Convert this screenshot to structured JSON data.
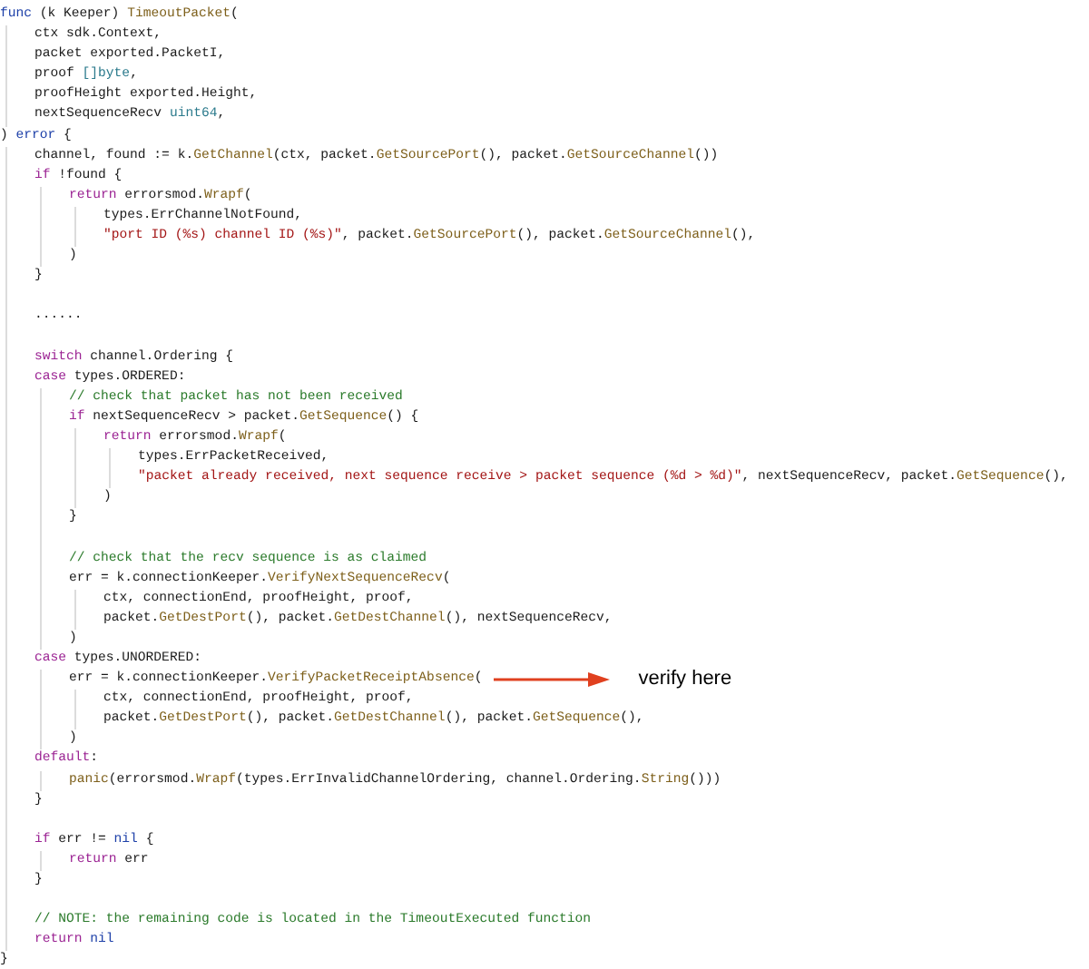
{
  "code": {
    "lines": [
      {
        "kind": "code",
        "tokens": [
          {
            "kind": "d",
            "text": "func"
          },
          {
            "kind": "p",
            "text": " (k Keeper) "
          },
          {
            "kind": "f",
            "text": "TimeoutPacket"
          },
          {
            "kind": "p",
            "text": "("
          }
        ],
        "children": [
          {
            "kind": "code",
            "tokens": [
              {
                "kind": "p",
                "text": "ctx sdk.Context,"
              }
            ]
          },
          {
            "kind": "code",
            "tokens": [
              {
                "kind": "p",
                "text": "packet exported.PacketI,"
              }
            ]
          },
          {
            "kind": "code",
            "tokens": [
              {
                "kind": "p",
                "text": "proof "
              },
              {
                "kind": "t",
                "text": "[]byte"
              },
              {
                "kind": "p",
                "text": ","
              }
            ]
          },
          {
            "kind": "code",
            "tokens": [
              {
                "kind": "p",
                "text": "proofHeight exported.Height,"
              }
            ]
          },
          {
            "kind": "code",
            "tokens": [
              {
                "kind": "p",
                "text": "nextSequenceRecv "
              },
              {
                "kind": "t",
                "text": "uint64"
              },
              {
                "kind": "p",
                "text": ","
              }
            ]
          }
        ]
      },
      {
        "kind": "code",
        "tokens": [
          {
            "kind": "p",
            "text": ") "
          },
          {
            "kind": "d",
            "text": "error"
          },
          {
            "kind": "p",
            "text": " {"
          }
        ],
        "children": [
          {
            "kind": "code",
            "tokens": [
              {
                "kind": "p",
                "text": "channel, found := k."
              },
              {
                "kind": "f",
                "text": "GetChannel"
              },
              {
                "kind": "p",
                "text": "(ctx, packet."
              },
              {
                "kind": "f",
                "text": "GetSourcePort"
              },
              {
                "kind": "p",
                "text": "(), packet."
              },
              {
                "kind": "f",
                "text": "GetSourceChannel"
              },
              {
                "kind": "p",
                "text": "())"
              }
            ]
          },
          {
            "kind": "code",
            "tokens": [
              {
                "kind": "k",
                "text": "if"
              },
              {
                "kind": "p",
                "text": " !found {"
              }
            ],
            "children": [
              {
                "kind": "code",
                "tokens": [
                  {
                    "kind": "k",
                    "text": "return"
                  },
                  {
                    "kind": "p",
                    "text": " errorsmod."
                  },
                  {
                    "kind": "f",
                    "text": "Wrapf"
                  },
                  {
                    "kind": "p",
                    "text": "("
                  }
                ],
                "children": [
                  {
                    "kind": "code",
                    "tokens": [
                      {
                        "kind": "p",
                        "text": "types.ErrChannelNotFound,"
                      }
                    ]
                  },
                  {
                    "kind": "code",
                    "tokens": [
                      {
                        "kind": "s",
                        "text": "\"port ID (%s) channel ID (%s)\""
                      },
                      {
                        "kind": "p",
                        "text": ", packet."
                      },
                      {
                        "kind": "f",
                        "text": "GetSourcePort"
                      },
                      {
                        "kind": "p",
                        "text": "(), packet."
                      },
                      {
                        "kind": "f",
                        "text": "GetSourceChannel"
                      },
                      {
                        "kind": "p",
                        "text": "(),"
                      }
                    ]
                  }
                ]
              },
              {
                "kind": "code",
                "tokens": [
                  {
                    "kind": "p",
                    "text": ")"
                  }
                ]
              }
            ]
          },
          {
            "kind": "code",
            "tokens": [
              {
                "kind": "p",
                "text": "}"
              }
            ]
          },
          {
            "kind": "blank"
          },
          {
            "kind": "code",
            "tokens": [
              {
                "kind": "p",
                "text": "......"
              }
            ]
          },
          {
            "kind": "blank"
          },
          {
            "kind": "code",
            "tokens": [
              {
                "kind": "k",
                "text": "switch"
              },
              {
                "kind": "p",
                "text": " channel.Ordering {"
              }
            ]
          },
          {
            "kind": "code",
            "tokens": [
              {
                "kind": "k",
                "text": "case"
              },
              {
                "kind": "p",
                "text": " types.ORDERED:"
              }
            ],
            "children": [
              {
                "kind": "code",
                "tokens": [
                  {
                    "kind": "c",
                    "text": "// check that packet has not been received"
                  }
                ]
              },
              {
                "kind": "code",
                "tokens": [
                  {
                    "kind": "k",
                    "text": "if"
                  },
                  {
                    "kind": "p",
                    "text": " nextSequenceRecv > packet."
                  },
                  {
                    "kind": "f",
                    "text": "GetSequence"
                  },
                  {
                    "kind": "p",
                    "text": "() {"
                  }
                ],
                "children": [
                  {
                    "kind": "code",
                    "tokens": [
                      {
                        "kind": "k",
                        "text": "return"
                      },
                      {
                        "kind": "p",
                        "text": " errorsmod."
                      },
                      {
                        "kind": "f",
                        "text": "Wrapf"
                      },
                      {
                        "kind": "p",
                        "text": "("
                      }
                    ],
                    "children": [
                      {
                        "kind": "code",
                        "tokens": [
                          {
                            "kind": "p",
                            "text": "types.ErrPacketReceived,"
                          }
                        ]
                      },
                      {
                        "kind": "code",
                        "tokens": [
                          {
                            "kind": "s",
                            "text": "\"packet already received, next sequence receive > packet sequence (%d > %d)\""
                          },
                          {
                            "kind": "p",
                            "text": ", nextSequenceRecv, packet."
                          },
                          {
                            "kind": "f",
                            "text": "GetSequence"
                          },
                          {
                            "kind": "p",
                            "text": "(),"
                          }
                        ]
                      }
                    ]
                  },
                  {
                    "kind": "code",
                    "tokens": [
                      {
                        "kind": "p",
                        "text": ")"
                      }
                    ]
                  }
                ]
              },
              {
                "kind": "code",
                "tokens": [
                  {
                    "kind": "p",
                    "text": "}"
                  }
                ]
              },
              {
                "kind": "blank"
              },
              {
                "kind": "code",
                "tokens": [
                  {
                    "kind": "c",
                    "text": "// check that the recv sequence is as claimed"
                  }
                ]
              },
              {
                "kind": "code",
                "tokens": [
                  {
                    "kind": "p",
                    "text": "err = k.connectionKeeper."
                  },
                  {
                    "kind": "f",
                    "text": "VerifyNextSequenceRecv"
                  },
                  {
                    "kind": "p",
                    "text": "("
                  }
                ],
                "children": [
                  {
                    "kind": "code",
                    "tokens": [
                      {
                        "kind": "p",
                        "text": "ctx, connectionEnd, proofHeight, proof,"
                      }
                    ]
                  },
                  {
                    "kind": "code",
                    "tokens": [
                      {
                        "kind": "p",
                        "text": "packet."
                      },
                      {
                        "kind": "f",
                        "text": "GetDestPort"
                      },
                      {
                        "kind": "p",
                        "text": "(), packet."
                      },
                      {
                        "kind": "f",
                        "text": "GetDestChannel"
                      },
                      {
                        "kind": "p",
                        "text": "(), nextSequenceRecv,"
                      }
                    ]
                  }
                ]
              },
              {
                "kind": "code",
                "tokens": [
                  {
                    "kind": "p",
                    "text": ")"
                  }
                ]
              }
            ]
          },
          {
            "kind": "code",
            "tokens": [
              {
                "kind": "k",
                "text": "case"
              },
              {
                "kind": "p",
                "text": " types.UNORDERED:"
              }
            ],
            "children": [
              {
                "kind": "code",
                "tokens": [
                  {
                    "kind": "p",
                    "text": "err = k.connectionKeeper."
                  },
                  {
                    "kind": "f",
                    "text": "VerifyPacketReceiptAbsence"
                  },
                  {
                    "kind": "p",
                    "text": "("
                  }
                ],
                "note": "verify here",
                "children": [
                  {
                    "kind": "code",
                    "tokens": [
                      {
                        "kind": "p",
                        "text": "ctx, connectionEnd, proofHeight, proof,"
                      }
                    ]
                  },
                  {
                    "kind": "code",
                    "tokens": [
                      {
                        "kind": "p",
                        "text": "packet."
                      },
                      {
                        "kind": "f",
                        "text": "GetDestPort"
                      },
                      {
                        "kind": "p",
                        "text": "(), packet."
                      },
                      {
                        "kind": "f",
                        "text": "GetDestChannel"
                      },
                      {
                        "kind": "p",
                        "text": "(), packet."
                      },
                      {
                        "kind": "f",
                        "text": "GetSequence"
                      },
                      {
                        "kind": "p",
                        "text": "(),"
                      }
                    ]
                  }
                ]
              },
              {
                "kind": "code",
                "tokens": [
                  {
                    "kind": "p",
                    "text": ")"
                  }
                ]
              }
            ]
          },
          {
            "kind": "code",
            "tokens": [
              {
                "kind": "k",
                "text": "default"
              },
              {
                "kind": "p",
                "text": ":"
              }
            ],
            "children": [
              {
                "kind": "code",
                "tokens": [
                  {
                    "kind": "f",
                    "text": "panic"
                  },
                  {
                    "kind": "p",
                    "text": "(errorsmod."
                  },
                  {
                    "kind": "f",
                    "text": "Wrapf"
                  },
                  {
                    "kind": "p",
                    "text": "(types.ErrInvalidChannelOrdering, channel.Ordering."
                  },
                  {
                    "kind": "f",
                    "text": "String"
                  },
                  {
                    "kind": "p",
                    "text": "()))"
                  }
                ]
              }
            ]
          },
          {
            "kind": "code",
            "tokens": [
              {
                "kind": "p",
                "text": "}"
              }
            ]
          },
          {
            "kind": "blank"
          },
          {
            "kind": "code",
            "tokens": [
              {
                "kind": "k",
                "text": "if"
              },
              {
                "kind": "p",
                "text": " err != "
              },
              {
                "kind": "d",
                "text": "nil"
              },
              {
                "kind": "p",
                "text": " {"
              }
            ],
            "children": [
              {
                "kind": "code",
                "tokens": [
                  {
                    "kind": "k",
                    "text": "return"
                  },
                  {
                    "kind": "p",
                    "text": " err"
                  }
                ]
              }
            ]
          },
          {
            "kind": "code",
            "tokens": [
              {
                "kind": "p",
                "text": "}"
              }
            ]
          },
          {
            "kind": "blank"
          },
          {
            "kind": "code",
            "tokens": [
              {
                "kind": "c",
                "text": "// NOTE: the remaining code is located in the TimeoutExecuted function"
              }
            ]
          },
          {
            "kind": "code",
            "tokens": [
              {
                "kind": "k",
                "text": "return "
              },
              {
                "kind": "d",
                "text": "nil"
              }
            ]
          }
        ]
      },
      {
        "kind": "code",
        "tokens": [
          {
            "kind": "p",
            "text": "}"
          }
        ]
      }
    ]
  }
}
